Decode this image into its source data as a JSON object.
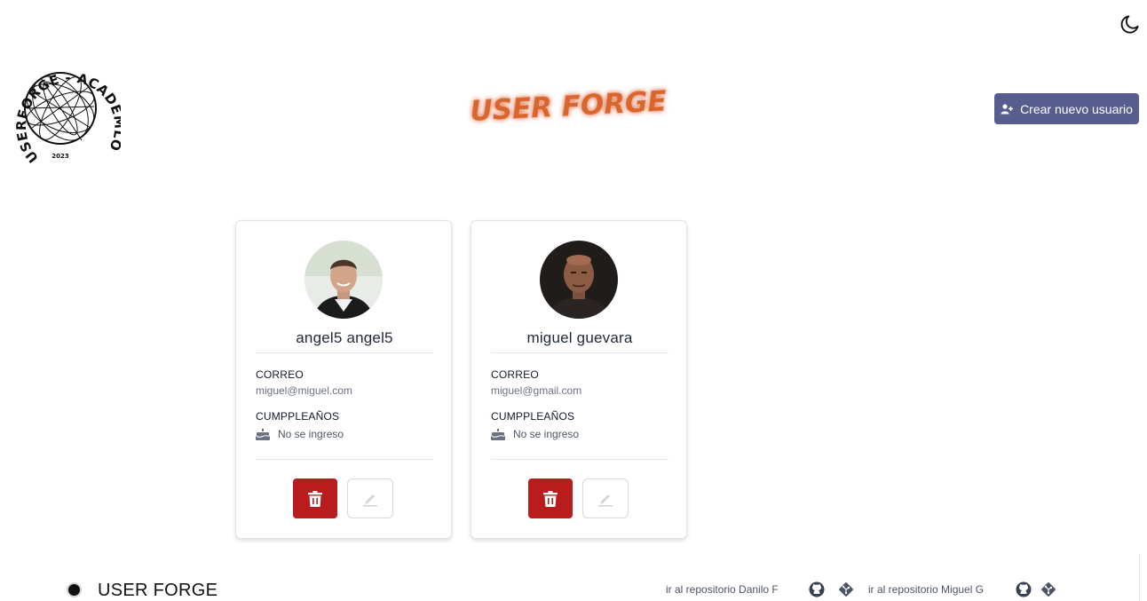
{
  "header": {
    "brand_title": "USER FORGE",
    "logo_text_top": "USERFORGE - ACADEMLO",
    "logo_year": "2023",
    "create_button_label": "Crear nuevo usuario",
    "theme_icon": "moon-icon"
  },
  "users": [
    {
      "name": "angel5 angel5",
      "email_label": "CORREO",
      "email": "miguel@miguel.com",
      "birthday_label": "CUMPPLEAÑOS",
      "birthday": "No se ingreso"
    },
    {
      "name": "miguel guevara",
      "email_label": "CORREO",
      "email": "miguel@gmail.com",
      "birthday_label": "CUMPPLEAÑOS",
      "birthday": "No se ingreso"
    }
  ],
  "footer": {
    "title": "USER FORGE",
    "repo_danilo": "ir al repositorio Danilo F",
    "repo_miguel": "ir al repositorio Miguel G"
  },
  "colors": {
    "primary_button": "#585d8f",
    "delete_button": "#b91c1c",
    "title_orange": "#d9662a"
  }
}
